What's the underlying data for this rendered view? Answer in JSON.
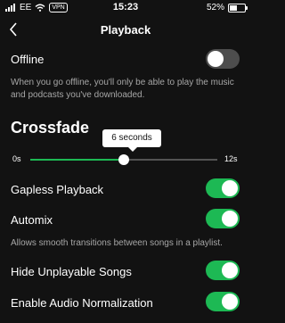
{
  "status_bar": {
    "signal_icon": "signal-bars-icon",
    "carrier": "EE",
    "wifi_icon": "wifi-icon",
    "vpn": "VPN",
    "time": "15:23",
    "battery_percent": "52%",
    "battery_level": 0.52
  },
  "header": {
    "back_icon": "chevron-left-icon",
    "title": "Playback"
  },
  "offline": {
    "label": "Offline",
    "enabled": false,
    "description": "When you go offline, you'll only be able to play the music and podcasts you've downloaded."
  },
  "crossfade": {
    "title": "Crossfade",
    "min_label": "0s",
    "max_label": "12s",
    "value_label": "6 seconds",
    "value": 6,
    "max": 12
  },
  "gapless": {
    "label": "Gapless Playback",
    "enabled": true
  },
  "automix": {
    "label": "Automix",
    "enabled": true,
    "description": "Allows smooth transitions between songs in a playlist."
  },
  "hide_unplayable": {
    "label": "Hide Unplayable Songs",
    "enabled": true
  },
  "normalization": {
    "label": "Enable Audio Normalization",
    "enabled": true
  },
  "colors": {
    "accent": "#1db954",
    "background": "#121212",
    "toggle_off": "#4d4d4d",
    "muted_text": "#a7a7a7"
  }
}
